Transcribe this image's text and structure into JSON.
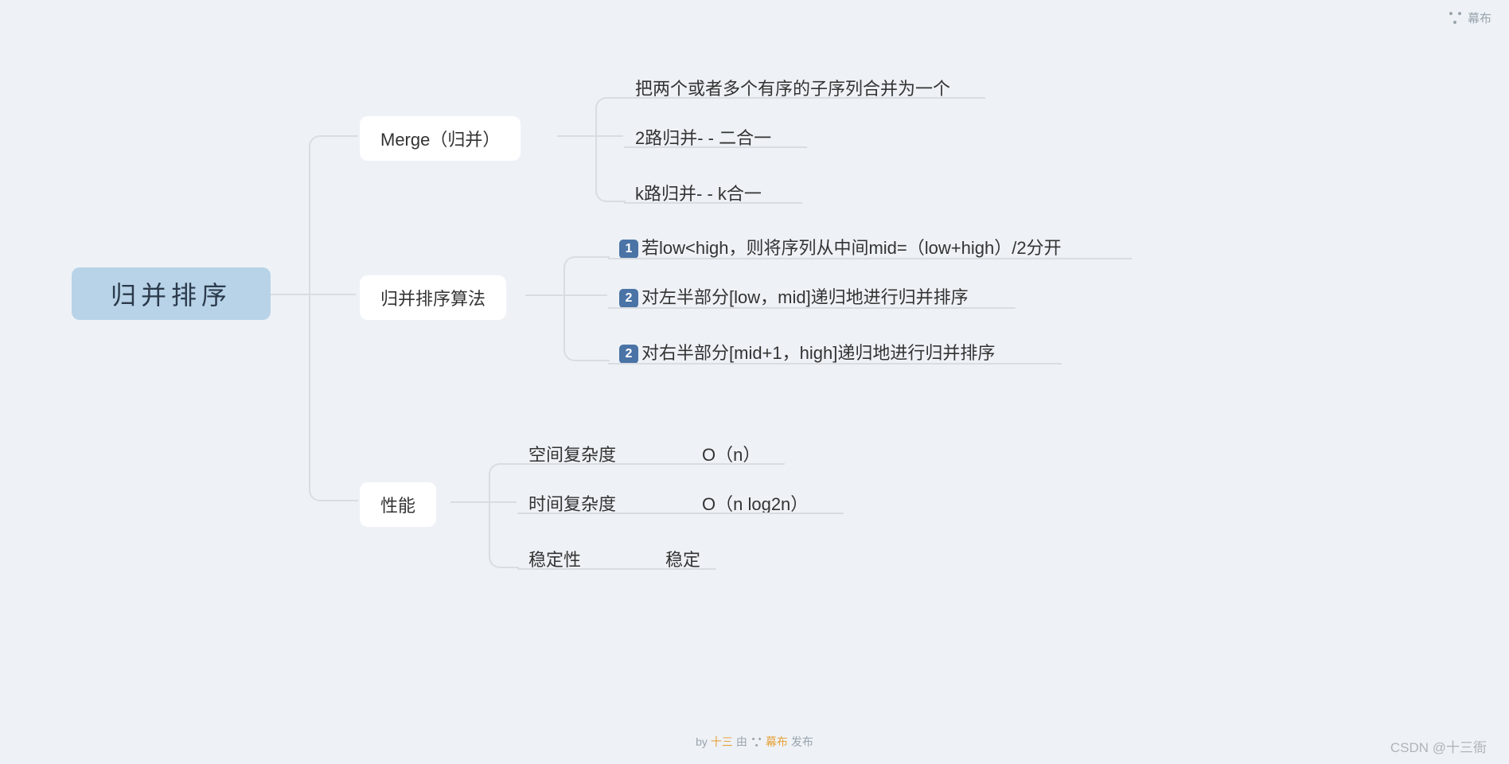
{
  "watermark_tr": "幕布",
  "watermark_br": "CSDN @十三衙",
  "attribution": {
    "by": "by",
    "author": "十三",
    "middle": "由",
    "brand": "幕布",
    "suffix": "发布"
  },
  "root": {
    "label": "归并排序"
  },
  "branches": {
    "merge": {
      "label": "Merge（归并）",
      "children": [
        "把两个或者多个有序的子序列合并为一个",
        "2路归并- - 二合一",
        "k路归并- - k合一"
      ]
    },
    "algo": {
      "label": "归并排序算法",
      "children": [
        {
          "num": "1",
          "text": "若low<high，则将序列从中间mid=（low+high）/2分开"
        },
        {
          "num": "2",
          "text": "对左半部分[low，mid]递归地进行归并排序"
        },
        {
          "num": "2",
          "text": "对右半部分[mid+1，high]递归地进行归并排序"
        }
      ]
    },
    "perf": {
      "label": "性能",
      "children": [
        {
          "k": "空间复杂度",
          "v": "O（n）"
        },
        {
          "k": "时间复杂度",
          "v": "O（n log2n）"
        },
        {
          "k": "稳定性",
          "v": "稳定"
        }
      ]
    }
  }
}
